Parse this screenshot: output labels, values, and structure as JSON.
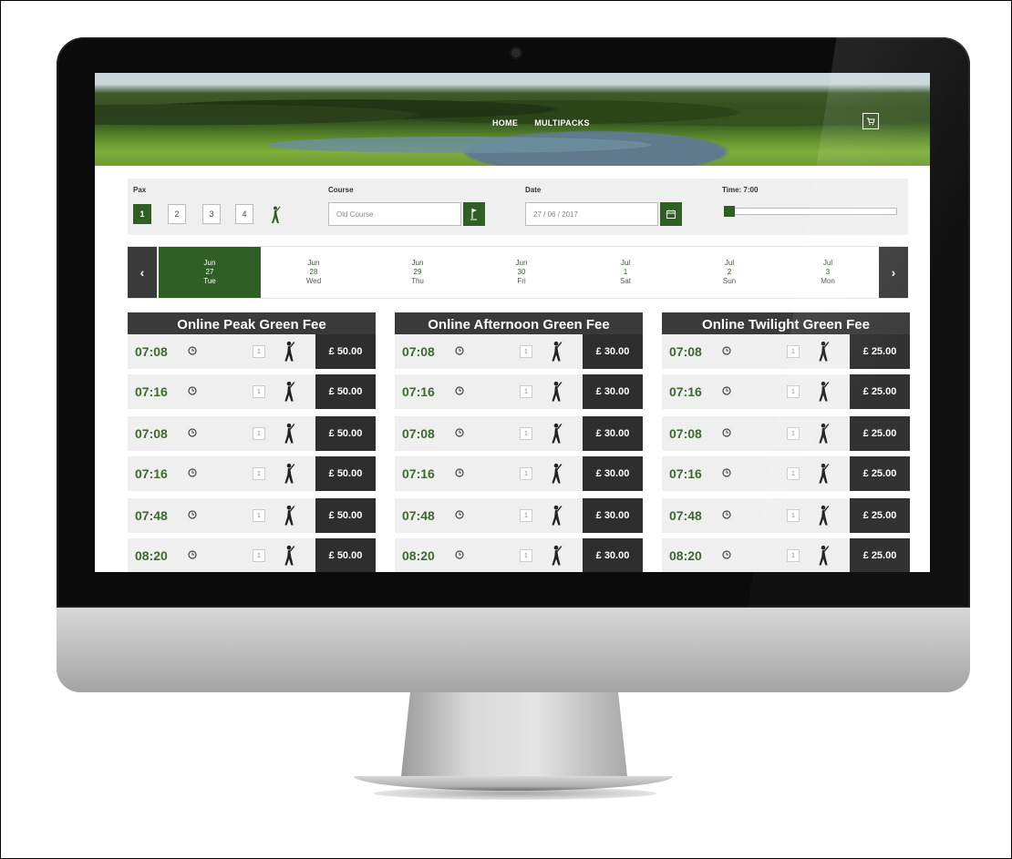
{
  "nav": {
    "home": "HOME",
    "multipacks": "MULTIPACKS"
  },
  "icons": {
    "cart": "cart-icon",
    "calendar": "calendar-icon",
    "flag": "flag-icon",
    "golfer": "golfer-icon",
    "clock": "clock-icon"
  },
  "colors": {
    "accent": "#2f5f24",
    "dark": "#3a3a3a",
    "time_text": "#3b6b2c",
    "panel": "#efefef"
  },
  "filters": {
    "pax_label": "Pax",
    "pax_options": [
      "1",
      "2",
      "3",
      "4"
    ],
    "pax_selected": "1",
    "course_label": "Course",
    "course_value": "Old Course",
    "date_label": "Date",
    "date_value": "27 / 06 / 2017",
    "time_label": "Time: 7:00"
  },
  "days": [
    {
      "month": "Jun",
      "day": "27",
      "dow": "Tue",
      "active": true
    },
    {
      "month": "Jun",
      "day": "28",
      "dow": "Wed"
    },
    {
      "month": "Jun",
      "day": "29",
      "dow": "Thu"
    },
    {
      "month": "Jun",
      "day": "30",
      "dow": "Fri"
    },
    {
      "month": "Jul",
      "day": "1",
      "dow": "Sat"
    },
    {
      "month": "Jul",
      "day": "2",
      "dow": "Sun"
    },
    {
      "month": "Jul",
      "day": "3",
      "dow": "Mon"
    }
  ],
  "arrows": {
    "prev": "‹",
    "next": "›"
  },
  "columns": [
    {
      "title": "Online Peak Green Fee",
      "rows": [
        {
          "time": "07:08",
          "qty": "1",
          "price": "£ 50.00"
        },
        {
          "time": "07:16",
          "qty": "1",
          "price": "£ 50.00"
        },
        {
          "time": "07:08",
          "qty": "1",
          "price": "£ 50.00"
        },
        {
          "time": "07:16",
          "qty": "1",
          "price": "£ 50.00"
        },
        {
          "time": "07:48",
          "qty": "1",
          "price": "£ 50.00"
        },
        {
          "time": "08:20",
          "qty": "1",
          "price": "£ 50.00"
        }
      ]
    },
    {
      "title": "Online Afternoon Green Fee",
      "rows": [
        {
          "time": "07:08",
          "qty": "1",
          "price": "£ 30.00"
        },
        {
          "time": "07:16",
          "qty": "1",
          "price": "£ 30.00"
        },
        {
          "time": "07:08",
          "qty": "1",
          "price": "£ 30.00"
        },
        {
          "time": "07:16",
          "qty": "1",
          "price": "£ 30.00"
        },
        {
          "time": "07:48",
          "qty": "1",
          "price": "£ 30.00"
        },
        {
          "time": "08:20",
          "qty": "1",
          "price": "£ 30.00"
        }
      ]
    },
    {
      "title": "Online Twilight Green Fee",
      "rows": [
        {
          "time": "07:08",
          "qty": "1",
          "price": "£ 25.00"
        },
        {
          "time": "07:16",
          "qty": "1",
          "price": "£ 25.00"
        },
        {
          "time": "07:08",
          "qty": "1",
          "price": "£ 25.00"
        },
        {
          "time": "07:16",
          "qty": "1",
          "price": "£ 25.00"
        },
        {
          "time": "07:48",
          "qty": "1",
          "price": "£ 25.00"
        },
        {
          "time": "08:20",
          "qty": "1",
          "price": "£ 25.00"
        }
      ]
    }
  ]
}
